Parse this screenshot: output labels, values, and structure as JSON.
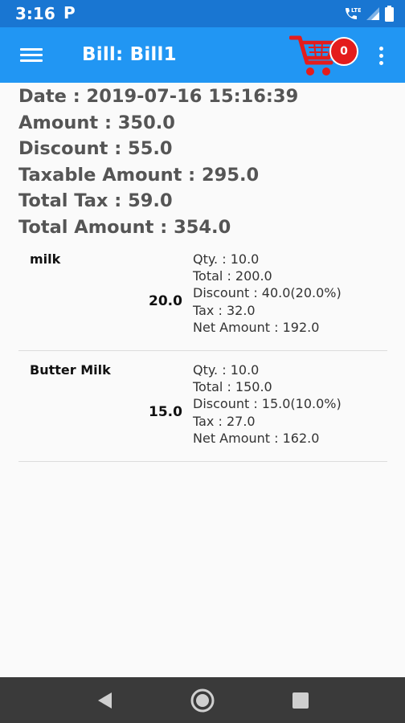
{
  "status_bar": {
    "time": "3:16",
    "notification_letter": "P",
    "lte_label": "LTE",
    "icons": [
      "parking-notification-icon",
      "call-lte-icon",
      "signal-icon",
      "battery-icon"
    ]
  },
  "app_bar": {
    "title": "Bill: Bill1",
    "cart_count": "0",
    "icons": [
      "menu-icon",
      "shopping-cart-icon",
      "more-vert-icon"
    ]
  },
  "summary": {
    "date": "Date : 2019-07-16 15:16:39",
    "amount": "Amount : 350.0",
    "discount": "Discount : 55.0",
    "taxable_amount": "Taxable Amount : 295.0",
    "total_tax": "Total Tax : 59.0",
    "total_amount": "Total Amount : 354.0"
  },
  "items": [
    {
      "name": "milk",
      "price": "20.0",
      "qty": "Qty. : 10.0",
      "total": "Total : 200.0",
      "discount": "Discount : 40.0(20.0%)",
      "tax": "Tax : 32.0",
      "net_amount": "Net Amount : 192.0"
    },
    {
      "name": "Butter Milk",
      "price": "15.0",
      "qty": "Qty. : 10.0",
      "total": "Total : 150.0",
      "discount": "Discount : 15.0(10.0%)",
      "tax": "Tax : 27.0",
      "net_amount": "Net Amount : 162.0"
    }
  ],
  "nav_bar": {
    "icons": [
      "back-icon",
      "home-icon",
      "recents-icon"
    ]
  },
  "colors": {
    "status_bar": "#1976d2",
    "app_bar": "#2196f3",
    "cart": "#e41c1c",
    "summary_text": "#555555",
    "nav_bar": "#3a3a3a",
    "background": "#fafafa"
  }
}
